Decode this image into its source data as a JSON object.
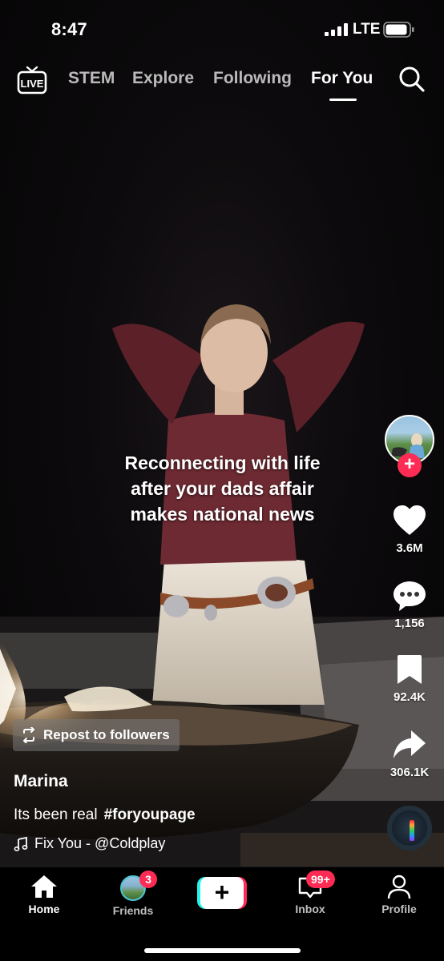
{
  "status_bar": {
    "time": "8:47",
    "network": "LTE"
  },
  "top_nav": {
    "tabs": [
      {
        "label": "STEM",
        "active": false
      },
      {
        "label": "Explore",
        "active": false
      },
      {
        "label": "Following",
        "active": false
      },
      {
        "label": "For You",
        "active": true
      }
    ],
    "live_label": "LIVE"
  },
  "video": {
    "caption_lines": [
      "Reconnecting with life",
      "after your dads affair",
      "makes national news"
    ]
  },
  "actions": {
    "likes": "3.6M",
    "comments": "1,156",
    "saves": "92.4K",
    "shares": "306.1K"
  },
  "post": {
    "repost_label": "Repost to followers",
    "author": "Marina",
    "description": "Its been real",
    "hashtag": "#foryoupage",
    "sound": "Fix You - @Coldplay"
  },
  "tab_bar": {
    "home": "Home",
    "friends": "Friends",
    "friends_badge": "3",
    "inbox": "Inbox",
    "inbox_badge": "99+",
    "profile": "Profile"
  },
  "colors": {
    "accent": "#fe2c55",
    "cyan": "#25f4ee"
  }
}
